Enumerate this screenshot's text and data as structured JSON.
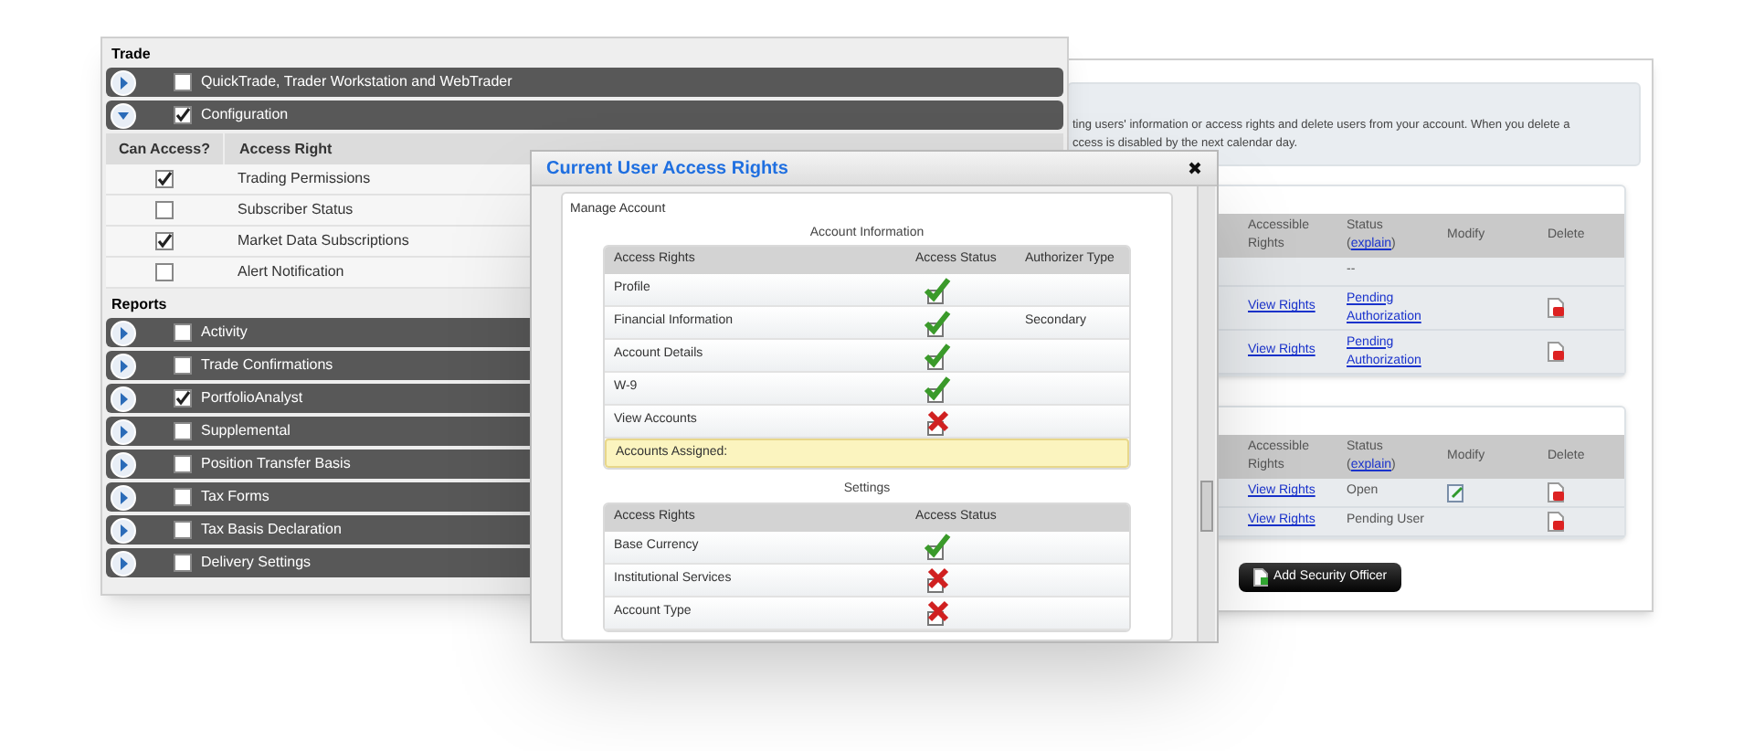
{
  "permissions_window": {
    "sections": [
      {
        "title": "Trade",
        "items": [
          {
            "label": "QuickTrade, Trader Workstation and WebTrader",
            "checked": false,
            "expanded": false
          },
          {
            "label": "Configuration",
            "checked": true,
            "expanded": true,
            "table": {
              "columns": [
                "Can Access?",
                "Access Right"
              ],
              "rows": [
                {
                  "label": "Trading Permissions",
                  "checked": true
                },
                {
                  "label": "Subscriber Status",
                  "checked": false
                },
                {
                  "label": "Market Data Subscriptions",
                  "checked": true
                },
                {
                  "label": "Alert Notification",
                  "checked": false
                }
              ]
            }
          }
        ]
      },
      {
        "title": "Reports",
        "items": [
          {
            "label": "Activity",
            "checked": false,
            "expanded": false
          },
          {
            "label": "Trade Confirmations",
            "checked": false,
            "expanded": false
          },
          {
            "label": "PortfolioAnalyst",
            "checked": true,
            "expanded": false
          },
          {
            "label": "Supplemental",
            "checked": false,
            "expanded": false
          },
          {
            "label": "Position Transfer Basis",
            "checked": false,
            "expanded": false
          },
          {
            "label": "Tax Forms",
            "checked": false,
            "expanded": false
          },
          {
            "label": "Tax Basis Declaration",
            "checked": false,
            "expanded": false
          },
          {
            "label": "Delivery Settings",
            "checked": false,
            "expanded": false
          }
        ]
      }
    ]
  },
  "users_window": {
    "description": [
      "ting users' information or access rights and delete users from your account. When you delete a",
      "ccess is disabled by the next calendar day."
    ],
    "tables": [
      {
        "columns": [
          {
            "label": "Accessible Rights"
          },
          {
            "label": "Status",
            "link_before": "(",
            "link": "explain",
            "link_after": ")"
          },
          {
            "label": "Modify"
          },
          {
            "label": "Delete"
          }
        ],
        "rows": [
          {
            "kind": "empty",
            "status": "--"
          },
          {
            "kind": "user",
            "rights": "View Rights",
            "status": "Pending Authorization",
            "status_link": true,
            "modify": false,
            "delete": true
          },
          {
            "kind": "user",
            "rights": "View Rights",
            "status": "Pending Authorization",
            "status_link": true,
            "modify": false,
            "delete": true
          }
        ]
      },
      {
        "columns": [
          {
            "label": "Accessible Rights"
          },
          {
            "label": "Status",
            "link_before": "(",
            "link": "explain",
            "link_after": ")"
          },
          {
            "label": "Modify"
          },
          {
            "label": "Delete"
          }
        ],
        "rows": [
          {
            "kind": "user",
            "rights": "View Rights",
            "status": "Open",
            "status_link": false,
            "modify": true,
            "delete": true
          },
          {
            "kind": "user",
            "rights": "View Rights",
            "status": "Pending User",
            "status_link": false,
            "modify": false,
            "delete": true
          }
        ]
      }
    ],
    "button": "Add Security Officer"
  },
  "modal": {
    "title": "Current User Access Rights",
    "panel_title": "Manage Account",
    "groups": [
      {
        "title": "Account Information",
        "columns": [
          "Access Rights",
          "Access Status",
          "Authorizer Type"
        ],
        "rows": [
          {
            "label": "Profile",
            "granted": true
          },
          {
            "label": "Financial Information",
            "granted": true,
            "authorizer": "Secondary"
          },
          {
            "label": "Account Details",
            "granted": true
          },
          {
            "label": "W-9",
            "granted": true
          },
          {
            "label": "View Accounts",
            "granted": false
          }
        ],
        "note": "Accounts Assigned:"
      },
      {
        "title": "Settings",
        "columns": [
          "Access Rights",
          "Access Status"
        ],
        "rows": [
          {
            "label": "Base Currency",
            "granted": true
          },
          {
            "label": "Institutional Services",
            "granted": false
          },
          {
            "label": "Account Type",
            "granted": false
          }
        ]
      }
    ]
  }
}
